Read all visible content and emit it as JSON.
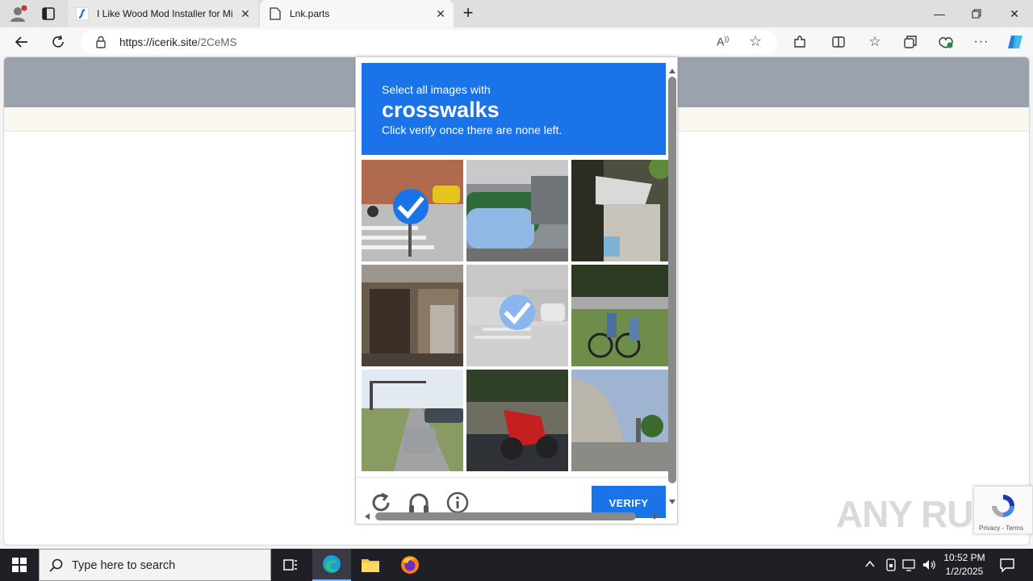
{
  "browser": {
    "tabs": [
      {
        "title": "I Like Wood Mod Installer for Mi"
      },
      {
        "title": "Lnk.parts"
      }
    ],
    "url": {
      "host": "https://icerik.site",
      "path": "/2CeMS"
    }
  },
  "captcha": {
    "prompt_line1": "Select all images with",
    "prompt_target": "crosswalks",
    "prompt_line3": "Click verify once there are none left.",
    "verify_label": "VERIFY",
    "tiles": [
      {
        "scene": "street-crosswalk-taxi",
        "selected": true
      },
      {
        "scene": "parked-cars-bins",
        "selected": false
      },
      {
        "scene": "storefront-awning",
        "selected": false
      },
      {
        "scene": "old-building-shutters",
        "selected": false
      },
      {
        "scene": "faded-street-crosswalk",
        "selected": true
      },
      {
        "scene": "cyclists-park",
        "selected": false
      },
      {
        "scene": "road-traffic-light-cars",
        "selected": false
      },
      {
        "scene": "red-motorcycle",
        "selected": false
      },
      {
        "scene": "overpass-road",
        "selected": false
      }
    ]
  },
  "watermark": "ANY RUN",
  "recaptcha_badge": "Privacy - Terms",
  "taskbar": {
    "search_placeholder": "Type here to search",
    "time": "10:52 PM",
    "date": "1/2/2025"
  },
  "colors": {
    "accent": "#1a73e8",
    "header_gray": "#9aa2ad"
  }
}
